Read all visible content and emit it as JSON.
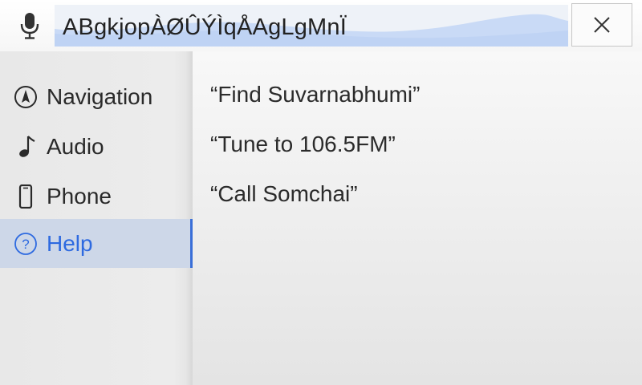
{
  "search": {
    "query": "ABgkjopÀØÛÝÌqÅAgLgMnÏ"
  },
  "sidebar": {
    "items": [
      {
        "label": "Navigation",
        "icon": "compass-icon"
      },
      {
        "label": "Audio",
        "icon": "music-note-icon"
      },
      {
        "label": "Phone",
        "icon": "phone-icon"
      },
      {
        "label": "Help",
        "icon": "help-icon",
        "active": true
      }
    ]
  },
  "content": {
    "commands": [
      "“Find Suvarnabhumi”",
      "“Tune to 106.5FM”",
      "“Call Somchai”"
    ]
  },
  "colors": {
    "accent": "#2e6ae0",
    "active_bg": "#cdd7e8",
    "search_bg": "#e3ebf6",
    "wave": "#c9daf6"
  }
}
